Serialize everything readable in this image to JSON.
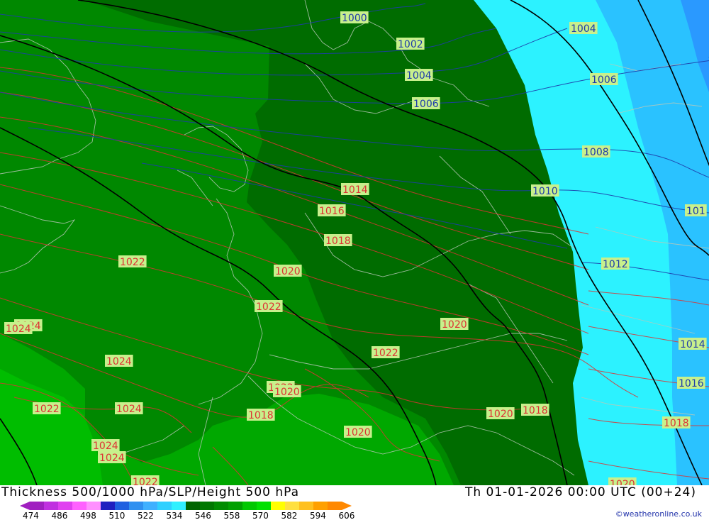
{
  "header": {
    "title": "Thickness 500/1000 hPa/SLP/Height 500 hPa",
    "datetime": "Th 01-01-2026 00:00 UTC (00+24)",
    "credit": "©weatheronline.co.uk"
  },
  "legend": {
    "ticks": [
      "474",
      "486",
      "498",
      "510",
      "522",
      "534",
      "546",
      "558",
      "570",
      "582",
      "594",
      "606"
    ],
    "colors": [
      "#a020c0",
      "#c030e0",
      "#e040f0",
      "#ff60ff",
      "#ff90ff",
      "#2020c0",
      "#2060e0",
      "#3090f0",
      "#40b0ff",
      "#30d0ff",
      "#30f0ff",
      "#006400",
      "#007800",
      "#008c00",
      "#00a000",
      "#00c800",
      "#00e000",
      "#ffff00",
      "#ffe040",
      "#ffc020",
      "#ffa000",
      "#ff8800"
    ]
  },
  "colors": {
    "thickness_dark": "#006c00",
    "thickness_mid": "#008800",
    "thickness_light": "#00a800",
    "thickness_lighter": "#00bd00",
    "cyan": "#2cf2ff",
    "sky": "#2ac2ff",
    "blue": "#2a99ff",
    "isobar_red": "#dd3333",
    "isobar_blue": "#1e3caa",
    "height_black": "#000000",
    "label_bg": "#c8f08c"
  },
  "isobar_labels": [
    {
      "text": "1000",
      "color": "blue"
    },
    {
      "text": "1002",
      "color": "blue"
    },
    {
      "text": "1004",
      "color": "blue"
    },
    {
      "text": "1006",
      "color": "blue"
    },
    {
      "text": "1004",
      "color": "blue"
    },
    {
      "text": "1006",
      "color": "blue"
    },
    {
      "text": "1008",
      "color": "blue"
    },
    {
      "text": "1010",
      "color": "blue"
    },
    {
      "text": "1012",
      "color": "blue"
    },
    {
      "text": "101",
      "color": "blue"
    },
    {
      "text": "1014",
      "color": "blue"
    },
    {
      "text": "1016",
      "color": "blue"
    },
    {
      "text": "1018",
      "color": "red"
    },
    {
      "text": "1014",
      "color": "red"
    },
    {
      "text": "1016",
      "color": "red"
    },
    {
      "text": "1018",
      "color": "red"
    },
    {
      "text": "1020",
      "color": "red"
    },
    {
      "text": "1022",
      "color": "red"
    },
    {
      "text": "1022",
      "color": "red"
    },
    {
      "text": "1020",
      "color": "red"
    },
    {
      "text": "1022",
      "color": "red"
    },
    {
      "text": "1024",
      "color": "red"
    },
    {
      "text": "1024",
      "color": "red"
    },
    {
      "text": "1024",
      "color": "red"
    },
    {
      "text": "1022",
      "color": "red"
    },
    {
      "text": "1024",
      "color": "red"
    },
    {
      "text": "1022",
      "color": "red"
    },
    {
      "text": "1020",
      "color": "red"
    },
    {
      "text": "1018",
      "color": "red"
    },
    {
      "text": "1020",
      "color": "red"
    },
    {
      "text": "1020",
      "color": "red"
    },
    {
      "text": "1018",
      "color": "red"
    },
    {
      "text": "1024",
      "color": "red"
    },
    {
      "text": "1024",
      "color": "red"
    },
    {
      "text": "1022",
      "color": "red"
    },
    {
      "text": "1020",
      "color": "red"
    }
  ]
}
